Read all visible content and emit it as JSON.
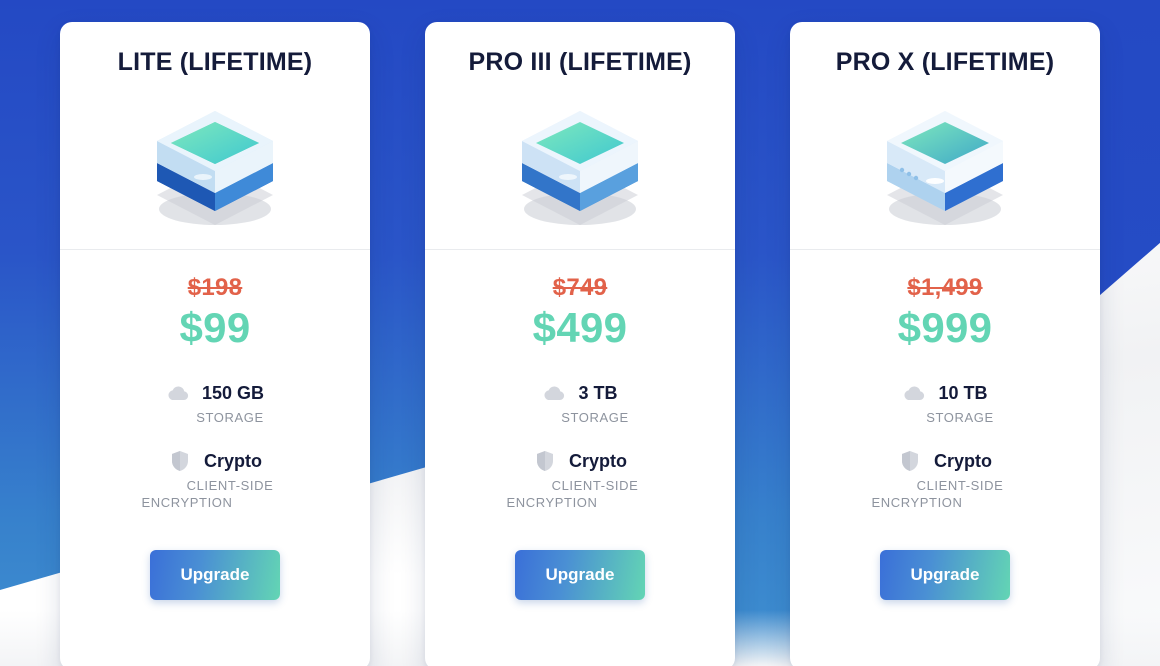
{
  "background": {
    "blue_dark": "#2449c4",
    "blue_light": "#3f90d0",
    "white": "#ffffff"
  },
  "theme": {
    "title_color": "#141b3a",
    "old_price_color": "#e2624a",
    "new_price_color": "#63d5b4",
    "sub_text_color": "#8d939e",
    "button_gradient_from": "#3a6fd8",
    "button_gradient_to": "#63d5b4"
  },
  "plans": [
    {
      "title": "LITE (LIFETIME)",
      "icon_name": "isometric-storage-box-dark",
      "old_price": "$198",
      "new_price": "$99",
      "features": [
        {
          "icon_name": "cloud-icon",
          "value": "150 GB",
          "sub": "STORAGE",
          "sub2": ""
        },
        {
          "icon_name": "shield-icon",
          "value": "Crypto",
          "sub": "CLIENT-SIDE",
          "sub2": "ENCRYPTION"
        }
      ],
      "cta_label": "Upgrade"
    },
    {
      "title": "PRO III (LIFETIME)",
      "icon_name": "isometric-storage-box-mid",
      "old_price": "$749",
      "new_price": "$499",
      "features": [
        {
          "icon_name": "cloud-icon",
          "value": "3 TB",
          "sub": "STORAGE",
          "sub2": ""
        },
        {
          "icon_name": "shield-icon",
          "value": "Crypto",
          "sub": "CLIENT-SIDE",
          "sub2": "ENCRYPTION"
        }
      ],
      "cta_label": "Upgrade"
    },
    {
      "title": "PRO X (LIFETIME)",
      "icon_name": "isometric-storage-box-light",
      "old_price": "$1,499",
      "new_price": "$999",
      "features": [
        {
          "icon_name": "cloud-icon",
          "value": "10 TB",
          "sub": "STORAGE",
          "sub2": ""
        },
        {
          "icon_name": "shield-icon",
          "value": "Crypto",
          "sub": "CLIENT-SIDE",
          "sub2": "ENCRYPTION"
        }
      ],
      "cta_label": "Upgrade"
    }
  ]
}
